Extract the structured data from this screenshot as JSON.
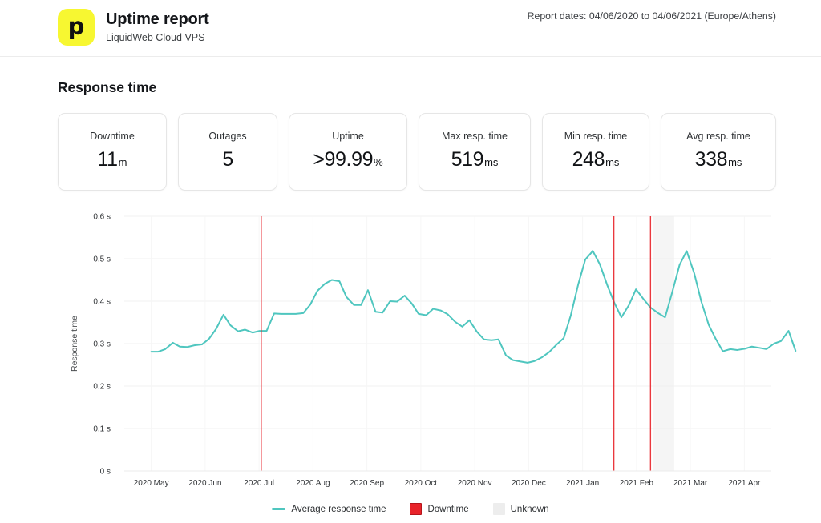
{
  "header": {
    "logo_glyph": "p",
    "title": "Uptime report",
    "subtitle": "LiquidWeb Cloud VPS",
    "report_dates": "Report dates: 04/06/2020 to 04/06/2021 (Europe/Athens)"
  },
  "section": {
    "title": "Response time"
  },
  "cards": [
    {
      "label": "Downtime",
      "value": "11",
      "unit": "m",
      "width_class": "w-downtime"
    },
    {
      "label": "Outages",
      "value": "5",
      "unit": "",
      "width_class": "w-outages"
    },
    {
      "label": "Uptime",
      "value": ">99.99",
      "unit": "%",
      "width_class": "w-uptime"
    },
    {
      "label": "Max resp. time",
      "value": "519",
      "unit": "ms",
      "width_class": "w-max"
    },
    {
      "label": "Min resp. time",
      "value": "248",
      "unit": "ms",
      "width_class": "w-min"
    },
    {
      "label": "Avg resp. time",
      "value": "338",
      "unit": "ms",
      "width_class": "w-avg"
    }
  ],
  "legend": [
    {
      "label": "Average response time",
      "marker": "line",
      "color": "#4fc6bf"
    },
    {
      "label": "Downtime",
      "marker": "swatch",
      "color": "#e8232a"
    },
    {
      "label": "Unknown",
      "marker": "swatch",
      "color": "#ededed"
    }
  ],
  "colors": {
    "brand_yellow": "#f7f731",
    "line": "#4fc6bf",
    "downtime": "#e8232a",
    "unknown": "#ededed",
    "grid": "#f0f0f0"
  },
  "chart_data": {
    "type": "line",
    "title": "Response time",
    "xlabel": "",
    "ylabel": "Response time",
    "ylim": [
      0,
      0.6
    ],
    "yunit": "s",
    "grid": true,
    "legend_position": "bottom",
    "ytick_labels": [
      "0 s",
      "0.1 s",
      "0.2 s",
      "0.3 s",
      "0.4 s",
      "0.5 s",
      "0.6 s"
    ],
    "ytick_values": [
      0,
      0.1,
      0.2,
      0.3,
      0.4,
      0.5,
      0.6
    ],
    "categories": [
      "2020 May",
      "2020 Jun",
      "2020 Jul",
      "2020 Aug",
      "2020 Sep",
      "2020 Oct",
      "2020 Nov",
      "2020 Dec",
      "2021 Jan",
      "2021 Feb",
      "2021 Mar",
      "2021 Apr"
    ],
    "series": [
      {
        "name": "Average response time",
        "color": "#4fc6bf",
        "x": [
          0.0,
          0.13,
          0.26,
          0.4,
          0.53,
          0.67,
          0.8,
          0.94,
          1.07,
          1.2,
          1.34,
          1.47,
          1.61,
          1.74,
          1.88,
          2.01,
          2.14,
          2.28,
          2.41,
          2.55,
          2.68,
          2.82,
          2.95,
          3.08,
          3.22,
          3.35,
          3.49,
          3.62,
          3.76,
          3.89,
          4.02,
          4.16,
          4.29,
          4.43,
          4.56,
          4.7,
          4.83,
          4.96,
          5.1,
          5.23,
          5.37,
          5.5,
          5.64,
          5.77,
          5.9,
          6.04,
          6.17,
          6.31,
          6.44,
          6.58,
          6.71,
          6.84,
          6.98,
          7.11,
          7.25,
          7.38,
          7.52,
          7.65,
          7.78,
          7.92,
          8.05,
          8.19,
          8.32,
          8.46,
          8.59,
          8.72,
          8.86,
          8.99,
          9.13,
          9.26,
          9.4,
          9.53,
          9.66,
          9.8,
          9.93,
          10.07,
          10.2,
          10.34,
          10.47,
          10.6,
          10.74,
          10.87,
          11.01
        ],
        "values": [
          0.281,
          0.281,
          0.287,
          0.302,
          0.293,
          0.292,
          0.296,
          0.298,
          0.311,
          0.334,
          0.368,
          0.343,
          0.329,
          0.333,
          0.326,
          0.33,
          0.33,
          0.371,
          0.37,
          0.37,
          0.37,
          0.372,
          0.392,
          0.424,
          0.441,
          0.45,
          0.447,
          0.41,
          0.391,
          0.391,
          0.426,
          0.375,
          0.373,
          0.4,
          0.399,
          0.413,
          0.395,
          0.37,
          0.367,
          0.382,
          0.378,
          0.369,
          0.351,
          0.34,
          0.355,
          0.328,
          0.31,
          0.308,
          0.31,
          0.272,
          0.261,
          0.258,
          0.255,
          0.259,
          0.268,
          0.28,
          0.298,
          0.313,
          0.366,
          0.44,
          0.498,
          0.518,
          0.487,
          0.437,
          0.396,
          0.362,
          0.391,
          0.428,
          0.405,
          0.385,
          0.372,
          0.362,
          0.42,
          0.486,
          0.518,
          0.466,
          0.4,
          0.344,
          0.311,
          0.282,
          0.287,
          0.285,
          0.288
        ],
        "values_tail_x": [
          11.14,
          11.28,
          11.41,
          11.55,
          11.68,
          11.82,
          11.95
        ],
        "values_tail": [
          0.293,
          0.29,
          0.287,
          0.3,
          0.306,
          0.33,
          0.283,
          0.292
        ]
      }
    ],
    "downtime_markers": [
      {
        "x": 2.04,
        "label": "Downtime"
      },
      {
        "x": 8.58,
        "label": "Downtime"
      },
      {
        "x": 9.26,
        "label": "Downtime"
      }
    ],
    "unknown_bands": [
      {
        "x_start": 9.3,
        "x_end": 9.7,
        "label": "Unknown"
      }
    ]
  }
}
